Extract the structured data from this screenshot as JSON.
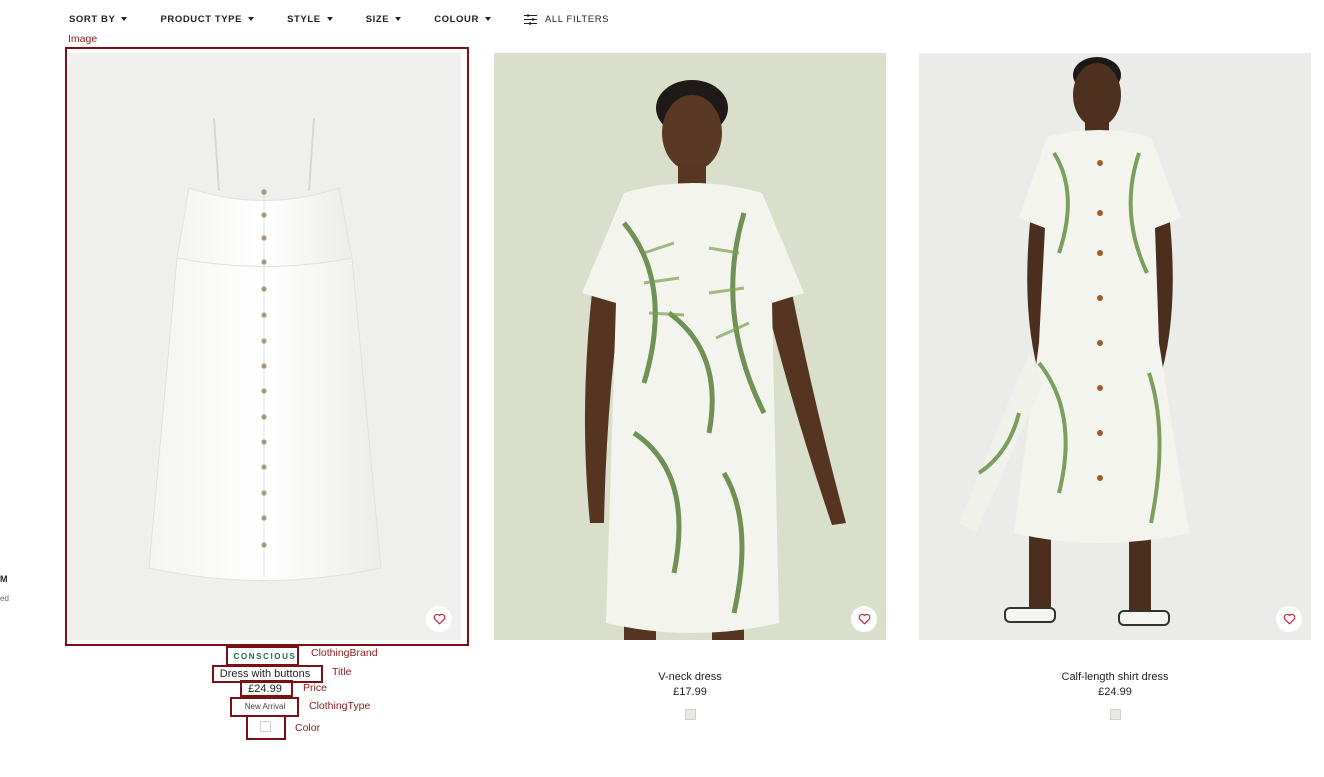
{
  "filters": [
    {
      "label": "SORT BY"
    },
    {
      "label": "PRODUCT TYPE"
    },
    {
      "label": "STYLE"
    },
    {
      "label": "SIZE"
    },
    {
      "label": "COLOUR"
    }
  ],
  "all_filters_label": "ALL FILTERS",
  "sidebar": {
    "size_fragment": "M",
    "fragment2": "ed"
  },
  "products": [
    {
      "brand": "CONSCIOUS",
      "title": "Dress with buttons",
      "price": "£24.99",
      "tag": "New Arrival",
      "swatch_color": "#ffffff"
    },
    {
      "title": "V-neck dress",
      "price": "£17.99",
      "swatch_color": "#e9e9e2"
    },
    {
      "title": "Calf-length shirt dress",
      "price": "£24.99",
      "swatch_color": "#e9e9e2"
    }
  ],
  "annotations": {
    "image": "Image",
    "brand": "ClothingBrand",
    "title": "Title",
    "price": "Price",
    "type": "ClothingType",
    "color": "Color"
  },
  "colors": {
    "annotation": "#7a0f14",
    "brand_green": "#1f6b4d",
    "heart": "#c8102e"
  }
}
